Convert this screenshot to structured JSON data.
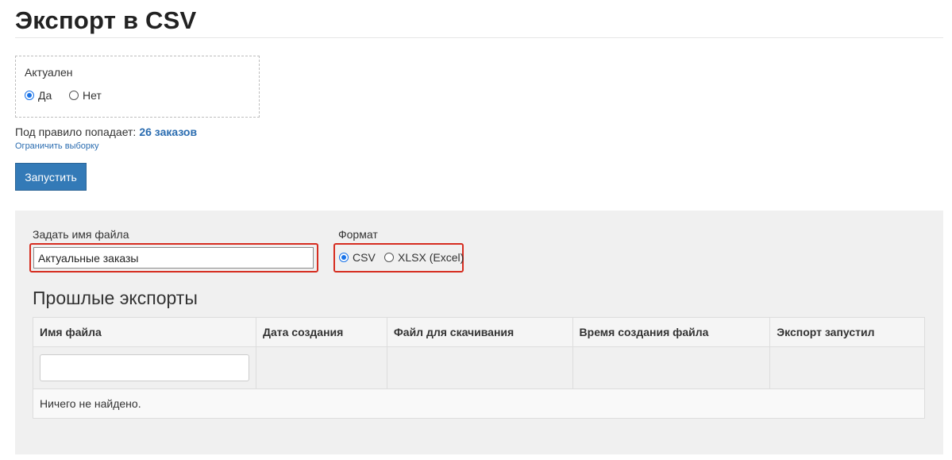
{
  "page": {
    "title": "Экспорт в CSV"
  },
  "filter": {
    "label": "Актуален",
    "options": [
      {
        "label": "Да",
        "checked": true
      },
      {
        "label": "Нет",
        "checked": false
      }
    ]
  },
  "rule": {
    "prefix": "Под правило попадает:",
    "count": "26 заказов",
    "limit_link": "Ограничить выборку"
  },
  "run_button": "Запустить",
  "export_form": {
    "filename_label": "Задать имя файла",
    "filename_value": "Актуальные заказы",
    "format_label": "Формат",
    "format_options": [
      {
        "label": "CSV",
        "checked": true
      },
      {
        "label": "XLSX (Excel)",
        "checked": false
      }
    ]
  },
  "past_exports": {
    "title": "Прошлые экспорты",
    "columns": [
      "Имя файла",
      "Дата создания",
      "Файл для скачивания",
      "Время создания файла",
      "Экспорт запустил"
    ],
    "filename_filter_value": "",
    "empty_text": "Ничего не найдено."
  },
  "colors": {
    "primary": "#337ab7",
    "link": "#2a6cb0",
    "highlight": "#d62d20",
    "panel_bg": "#f0f0f0"
  }
}
